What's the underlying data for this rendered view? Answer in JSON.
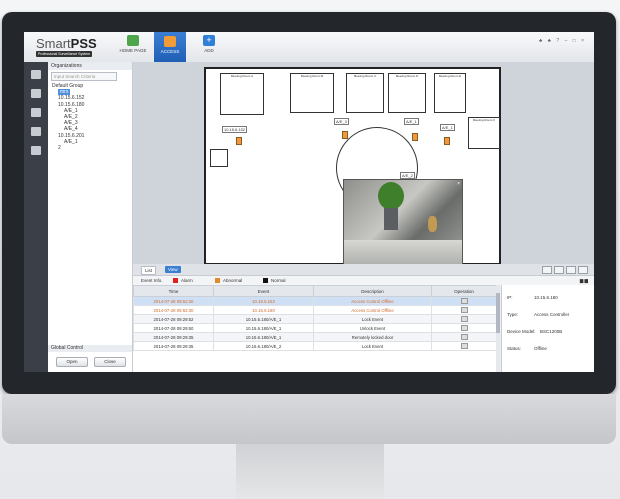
{
  "app": {
    "brand_prefix": "Smart",
    "brand_suffix": "PSS",
    "subtitle": "Professional Surveillance System"
  },
  "nav": {
    "home": "HOME PAGE",
    "access": "ACCESS",
    "add": "ADD",
    "add_symbol": "+"
  },
  "window_controls": "♣ ♣ ? – □ ×",
  "org": {
    "header": "Organizations",
    "search_placeholder": "Input Search Criteria",
    "tree": [
      {
        "label": "Default Group",
        "indent": 0
      },
      {
        "label": "mrs",
        "indent": 1,
        "selected": true
      },
      {
        "label": "10.15.6.152",
        "indent": 1
      },
      {
        "label": "10.15.6.180",
        "indent": 1
      },
      {
        "label": "A/E_1",
        "indent": 2
      },
      {
        "label": "A/E_2",
        "indent": 2
      },
      {
        "label": "A/E_3",
        "indent": 2
      },
      {
        "label": "A/E_4",
        "indent": 2
      },
      {
        "label": "10.15.6.201",
        "indent": 1
      },
      {
        "label": "A/E_1",
        "indent": 2
      },
      {
        "label": "2",
        "indent": 1
      }
    ],
    "global_control": "Global Control",
    "open_button": "Open",
    "close_button": "Close"
  },
  "map": {
    "rooms": [
      "Meeting Room A",
      "Meeting Room B",
      "Meeting Room C",
      "Meeting Room D",
      "Meeting Room E",
      "Meeting Room F"
    ],
    "labels": {
      "dev1": "10.15.6.152",
      "dev2": "A/E_3",
      "dev3": "A/E_1",
      "dev4": "A/E_2",
      "dev5": "A/E_1",
      "lg": "LG"
    }
  },
  "tabs": {
    "list": "List",
    "view": "View"
  },
  "legend": {
    "event_info": "Event Info.",
    "alarm": "Alarm",
    "abnormal": "Abnormal",
    "normal": "Normal",
    "alarm_color": "#e02020",
    "abnormal_color": "#e08a2a",
    "normal_color": "#111111"
  },
  "table": {
    "headers": [
      "Time",
      "Event",
      "Description",
      "Operation"
    ],
    "rows": [
      {
        "time": "2014-07-28 09:52:30",
        "event": "10.15.6.152",
        "desc": "Access Control Offline",
        "cls": "r1"
      },
      {
        "time": "2014-07-28 09:52:30",
        "event": "10.15.6.180",
        "desc": "Access Control Offline",
        "cls": "r2"
      },
      {
        "time": "2014-07-28 09:29:52",
        "event": "10.15.6.180/A/E_1",
        "desc": "Lock Event",
        "cls": "alt"
      },
      {
        "time": "2014-07-28 09:29:50",
        "event": "10.15.6.180/A/E_1",
        "desc": "Unlock Event",
        "cls": ""
      },
      {
        "time": "2014-07-28 09:29:35",
        "event": "10.15.6.180/A/E_1",
        "desc": "Remotely locked door",
        "cls": "alt"
      },
      {
        "time": "2014-07-28 09:29:35",
        "event": "10.15.6.180/A/E_2",
        "desc": "Lock Event",
        "cls": ""
      }
    ]
  },
  "info": {
    "ip_label": "IP:",
    "ip_value": "10.15.6.180",
    "type_label": "Type:",
    "type_value": "Access Controller",
    "model_label": "Device Model:",
    "model_value": "BSC1200B",
    "status_label": "Status:",
    "status_value": "Offline",
    "actions": "▆ ▆"
  }
}
